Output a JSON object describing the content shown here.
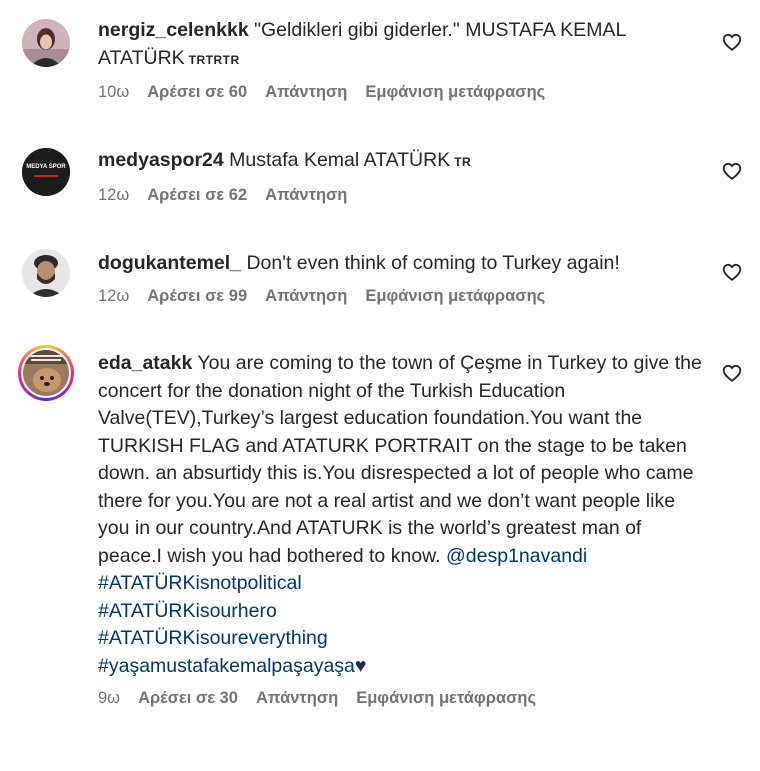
{
  "comments": [
    {
      "username": "nergiz_celenkkk",
      "text": "\"Geldikleri gibi giderler.\" MUSTAFA KEMAL ATATÜRK",
      "flag": "TRTRTR",
      "time": "10ω",
      "likes": "Αρέσει σε 60",
      "reply": "Απάντηση",
      "translate": "Εμφάνιση μετάφρασης"
    },
    {
      "username": "medyaspor24",
      "text": "Mustafa Kemal ATATÜRK",
      "flag": "TR",
      "time": "12ω",
      "likes": "Αρέσει σε 62",
      "reply": "Απάντηση",
      "avatar_text": "MEDYA SPOR"
    },
    {
      "username": "dogukantemel_",
      "text": "Don't even think of coming to Turkey again!",
      "time": "12ω",
      "likes": "Αρέσει σε 99",
      "reply": "Απάντηση",
      "translate": "Εμφάνιση μετάφρασης"
    },
    {
      "username": "eda_atakk",
      "text": "You are coming to the town of Çeşme in Turkey to give the concert for the donation night of the Turkish Education Valve(TEV),Turkey’s largest education foundation.You want the TURKISH FLAG and ATATURK PORTRAIT on the stage to be taken down. an absurtidy this is.You disrespected a lot of people who came there for you.You are not a real artist and we don’t want people like you in our country.And ATATURK is the world’s greatest man of peace.I wish you had bothered to know.",
      "mention": "@desp1navandi",
      "hashtags": [
        "#ATATÜRKisnotpolitical",
        "#ATATÜRKisourhero",
        "#ATATÜRKisoureverything",
        "#yaşamustafakemalpaşayaşa"
      ],
      "end_emoji": "♥",
      "time": "9ω",
      "likes": "Αρέσει σε 30",
      "reply": "Απάντηση",
      "translate": "Εμφάνιση μετάφρασης"
    }
  ],
  "colors": {
    "text": "#262626",
    "meta": "#737373",
    "link": "#00376b",
    "story_ring_start": "#f9ce34",
    "story_ring_mid": "#ee2a7b",
    "story_ring_end": "#6228d7"
  },
  "icons": {
    "like": "heart-outline-icon"
  }
}
